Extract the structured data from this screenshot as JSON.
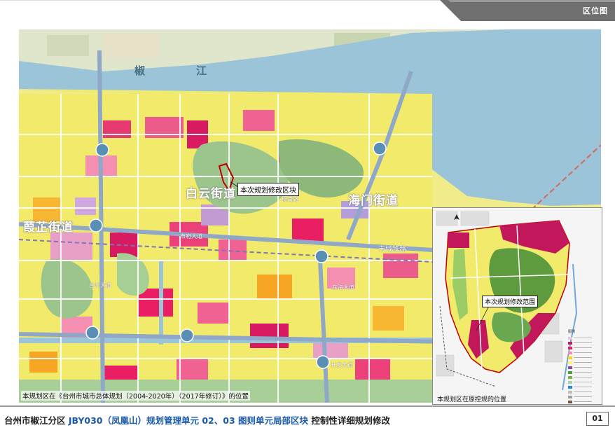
{
  "header": {
    "section_title": "区位图"
  },
  "main_map": {
    "callout": "本次规划修改区块",
    "caption": "本规划区在《台州市城市总体规划（2004-2020年）（2017年修订）》的位置",
    "river_chars": [
      "椒",
      "江"
    ],
    "districts": [
      "白云街道",
      "海门街道",
      "葭芷街道"
    ],
    "road_labels": [
      "市域铁路",
      "东海大道",
      "枫南路",
      "市府大道",
      "台州大道",
      "开发大道"
    ]
  },
  "inset_map": {
    "callout": "本次规划修改范围",
    "caption": "本规划区在原控规的位置",
    "legend_title": "图例",
    "legend": [
      {
        "color": "#e6c8dc"
      },
      {
        "color": "#c2185b"
      },
      {
        "color": "#e91e63"
      },
      {
        "color": "#f48fb1"
      },
      {
        "color": "#ffd600"
      },
      {
        "color": "#fff176"
      },
      {
        "color": "#8e44ad"
      },
      {
        "color": "#43a047"
      },
      {
        "color": "#7cb342"
      },
      {
        "color": "#a5d6a7"
      },
      {
        "color": "#1e88e5"
      },
      {
        "color": "#bdbdbd"
      },
      {
        "color": "#9e9e9e"
      },
      {
        "color": "#795548"
      },
      {
        "color": "#616161"
      }
    ]
  },
  "footer": {
    "title_prefix": "台州市椒江分区 ",
    "title_code": "JBY030（凤凰山）规划管理单元 02、03 图则单元局部区块",
    "title_suffix": " 控制性详细规划修改",
    "page_number": "01"
  }
}
